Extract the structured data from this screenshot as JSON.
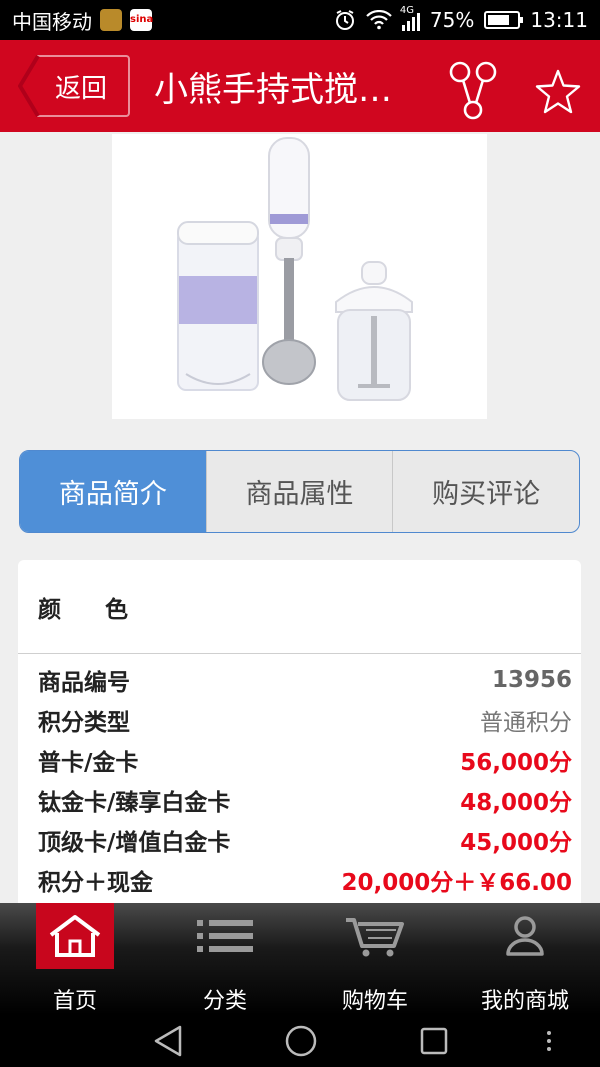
{
  "status_bar": {
    "carrier": "中国移动",
    "network": "4G",
    "battery_percent": "75%",
    "battery_level": 0.75,
    "time": "13:11"
  },
  "header": {
    "back_label": "返回",
    "title": "小熊手持式搅…",
    "share_icon": "share-icon",
    "favorite_icon": "star-icon",
    "bg_color": "#d0061f"
  },
  "tabs": [
    {
      "label": "商品简介",
      "active": true
    },
    {
      "label": "商品属性",
      "active": false
    },
    {
      "label": "购买评论",
      "active": false
    }
  ],
  "details": {
    "color_label": "颜色",
    "rows": [
      {
        "label": "商品编号",
        "value": "13956",
        "style": "gray"
      },
      {
        "label": "积分类型",
        "value": "普通积分",
        "style": "gray-normal"
      },
      {
        "label": "普卡/金卡",
        "value": "56,000分",
        "style": "red"
      },
      {
        "label": "钛金卡/臻享白金卡",
        "value": "48,000分",
        "style": "red"
      },
      {
        "label": "顶级卡/增值白金卡",
        "value": "45,000分",
        "style": "red"
      },
      {
        "label": "积分＋现金",
        "value": "20,000分＋￥66.00",
        "style": "red"
      }
    ]
  },
  "bottom_nav": [
    {
      "label": "首页",
      "icon": "home-icon",
      "active": true
    },
    {
      "label": "分类",
      "icon": "list-icon",
      "active": false
    },
    {
      "label": "购物车",
      "icon": "cart-icon",
      "active": false
    },
    {
      "label": "我的商城",
      "icon": "user-icon",
      "active": false
    }
  ]
}
